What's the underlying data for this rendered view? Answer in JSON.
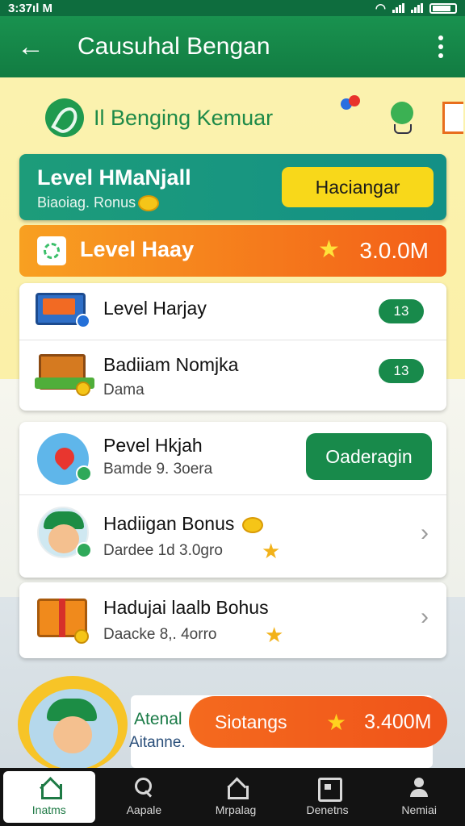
{
  "status_bar": {
    "time": "3:37",
    "carrier": "M"
  },
  "app_bar": {
    "title": "Causuhal Bengan",
    "back_icon": "arrow-left-icon",
    "menu_icon": "more-vert-icon"
  },
  "brand": {
    "name": "Il Benging Kemuar"
  },
  "level_banner": {
    "title": "Level HMaNjall",
    "subtitle": "Biaoiag. Ronus",
    "button_label": "Haciangar"
  },
  "level_bar": {
    "title": "Level Haay",
    "value": "3.0.0M"
  },
  "list_top": [
    {
      "name": "Level Harjay",
      "sub": "",
      "badge": "13"
    },
    {
      "name": "Badiiam Nomjka",
      "sub": "Dama",
      "badge": "13"
    }
  ],
  "list_middle": [
    {
      "name": "Pevel Hkjah",
      "sub": "Bamde 9. 3oera",
      "button_label": "Oaderagin"
    },
    {
      "name": "Hadiigan Bonus",
      "sub": "Dardee 1d 3.0gro"
    }
  ],
  "list_bottom": {
    "name": "Hadujai laalb Bohus",
    "sub": "Daacke 8,. 4orro"
  },
  "promo": {
    "title": "Atenal",
    "subtitle": "Aitanne.",
    "button_label": "Siotangs",
    "value": "3.400M"
  },
  "bottom_nav": [
    {
      "label": "Inatms",
      "icon": "home-icon",
      "active": true
    },
    {
      "label": "Aapale",
      "icon": "search-icon",
      "active": false
    },
    {
      "label": "Mrpalag",
      "icon": "house-icon",
      "active": false
    },
    {
      "label": "Denetns",
      "icon": "box-icon",
      "active": false
    },
    {
      "label": "Nemiai",
      "icon": "user-icon",
      "active": false
    }
  ],
  "colors": {
    "primary_green": "#188a4b",
    "accent_orange": "#f35e18",
    "accent_yellow": "#f8d81a",
    "teal": "#139086"
  }
}
